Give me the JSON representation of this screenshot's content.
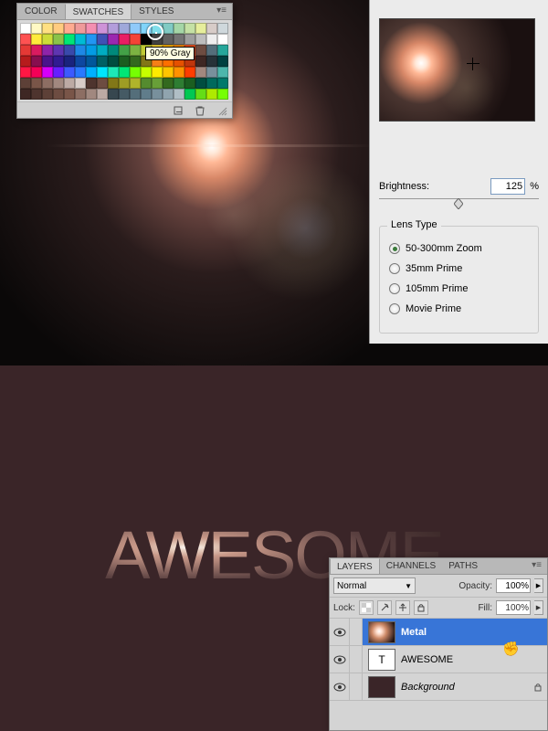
{
  "swatches": {
    "tabs": [
      "COLOR",
      "SWATCHES",
      "STYLES"
    ],
    "active_tab": 1,
    "tooltip": "90% Gray",
    "colors": [
      "#ffffff",
      "#fff9c4",
      "#ffe082",
      "#ffcc80",
      "#ffab91",
      "#ef9a9a",
      "#f48fb1",
      "#ce93d8",
      "#b39ddb",
      "#9fa8da",
      "#90caf9",
      "#81d4fa",
      "#80deea",
      "#80cbc4",
      "#a5d6a7",
      "#c5e1a5",
      "#e6ee9c",
      "#d7ccc8",
      "#cfd8dc",
      "#ff5252",
      "#ffeb3b",
      "#cddc39",
      "#8bc34a",
      "#00e676",
      "#00bcd4",
      "#2196f3",
      "#3f51b5",
      "#9c27b0",
      "#e91e63",
      "#f44336",
      "#000000",
      "#424242",
      "#616161",
      "#757575",
      "#9e9e9e",
      "#bdbdbd",
      "#eeeeee",
      "#ffffff",
      "#e53935",
      "#d81b60",
      "#8e24aa",
      "#5e35b1",
      "#3949ab",
      "#1e88e5",
      "#039be5",
      "#00acc1",
      "#00897b",
      "#43a047",
      "#7cb342",
      "#c0ca33",
      "#fdd835",
      "#ffb300",
      "#fb8c00",
      "#f4511e",
      "#6d4c41",
      "#546e7a",
      "#26a69a",
      "#b71c1c",
      "#880e4f",
      "#4a148c",
      "#311b92",
      "#1a237e",
      "#0d47a1",
      "#01579b",
      "#006064",
      "#004d40",
      "#1b5e20",
      "#33691e",
      "#827717",
      "#f57f17",
      "#ff6f00",
      "#e65100",
      "#bf360c",
      "#3e2723",
      "#263238",
      "#004040",
      "#ff1744",
      "#f50057",
      "#d500f9",
      "#651fff",
      "#3d5afe",
      "#2979ff",
      "#00b0ff",
      "#00e5ff",
      "#1de9b6",
      "#00e676",
      "#76ff03",
      "#c6ff00",
      "#ffea00",
      "#ffc400",
      "#ff9100",
      "#ff3d00",
      "#a1887f",
      "#78909c",
      "#4db6ac",
      "#5d4037",
      "#795548",
      "#8d6e63",
      "#a1887f",
      "#bcaaa4",
      "#d7ccc8",
      "#4e342e",
      "#6d4c41",
      "#827717",
      "#9e9d24",
      "#afb42b",
      "#558b2f",
      "#689f38",
      "#33691e",
      "#2e7d32",
      "#1b5e20",
      "#004d40",
      "#00695c",
      "#00796b",
      "#3e2723",
      "#4e342e",
      "#5d4037",
      "#6d4c41",
      "#795548",
      "#8d6e63",
      "#a1887f",
      "#bcaaa4",
      "#37474f",
      "#455a64",
      "#546e7a",
      "#607d8b",
      "#78909c",
      "#90a4ae",
      "#b0bec5",
      "#00c853",
      "#64dd17",
      "#aeea00",
      "#76ff03"
    ]
  },
  "flare": {
    "brightness_label": "Brightness:",
    "brightness_value": "125",
    "brightness_unit": "%",
    "group_label": "Lens Type",
    "types": [
      "50-300mm Zoom",
      "35mm Prime",
      "105mm Prime",
      "Movie Prime"
    ],
    "selected_type": 0
  },
  "canvas": {
    "text": "AWESOME"
  },
  "layers": {
    "tabs": [
      "LAYERS",
      "CHANNELS",
      "PATHS"
    ],
    "active_tab": 0,
    "blend_mode": "Normal",
    "opacity_label": "Opacity:",
    "opacity_value": "100%",
    "fill_label": "Fill:",
    "fill_value": "100%",
    "lock_label": "Lock:",
    "items": [
      {
        "name": "Metal",
        "type": "image",
        "selected": true,
        "locked": false
      },
      {
        "name": "AWESOME",
        "type": "text",
        "selected": false,
        "locked": false
      },
      {
        "name": "Background",
        "type": "bg",
        "selected": false,
        "locked": true
      }
    ]
  }
}
